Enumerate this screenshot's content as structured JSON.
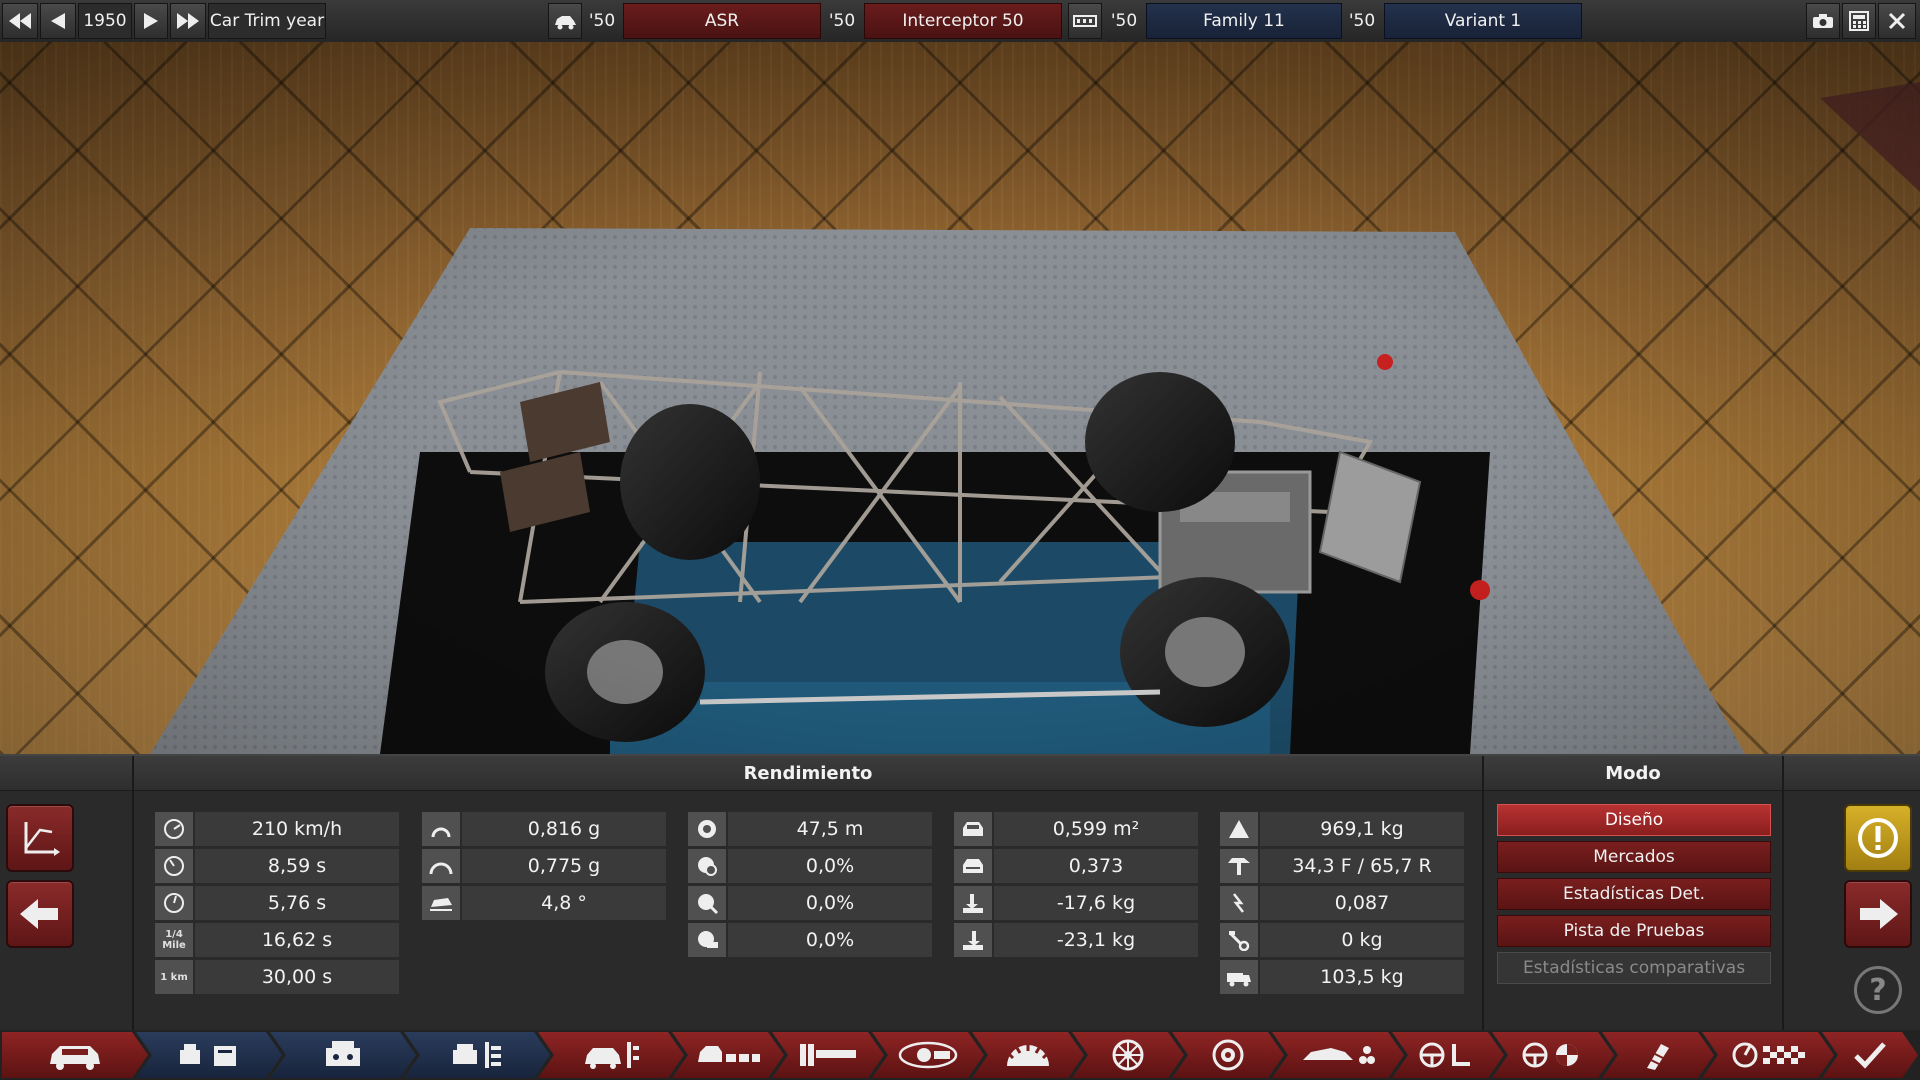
{
  "topbar": {
    "year": "1950",
    "year_label": "Car Trim year",
    "model_year": "'50",
    "model_name": "ASR",
    "trim_year": "'50",
    "trim_name": "Interceptor 50",
    "family_year": "'50",
    "family_name": "Family 11",
    "variant_year": "'50",
    "variant_name": "Variant 1",
    "icons": [
      "rewind-icon",
      "step-back-icon",
      "step-forward-icon",
      "fast-forward-icon",
      "car-model-icon",
      "engine-family-icon",
      "camera-icon",
      "calculator-icon",
      "close-icon"
    ]
  },
  "panel": {
    "performance_title": "Rendimiento",
    "mode_title": "Modo",
    "stats": {
      "col1": [
        {
          "icon": "top-speed-icon",
          "value": "210 km/h"
        },
        {
          "icon": "acceleration-0-100-icon",
          "value": "8,59 s"
        },
        {
          "icon": "acceleration-0-60-icon",
          "value": "5,76 s"
        },
        {
          "icon": "quarter-mile-icon",
          "value": "16,62 s",
          "icon_text": "1/4 Mile"
        },
        {
          "icon": "one-km-icon",
          "value": "30,00 s",
          "icon_text": "1 km"
        }
      ],
      "col2": [
        {
          "icon": "cornering-grip-icon",
          "value": "0,816 g"
        },
        {
          "icon": "cornering-grip-2-icon",
          "value": "0,775 g"
        },
        {
          "icon": "body-roll-icon",
          "value": "4,8 °"
        }
      ],
      "col3": [
        {
          "icon": "braking-distance-icon",
          "value": "47,5 m"
        },
        {
          "icon": "brake-fade-icon",
          "value": "0,0%"
        },
        {
          "icon": "brake-fade-2-icon",
          "value": "0,0%"
        },
        {
          "icon": "brake-fade-3-icon",
          "value": "0,0%"
        }
      ],
      "col4": [
        {
          "icon": "frontal-area-icon",
          "value": "0,599 m²"
        },
        {
          "icon": "drag-coefficient-icon",
          "value": "0,373"
        },
        {
          "icon": "front-downforce-icon",
          "value": "-17,6 kg"
        },
        {
          "icon": "rear-downforce-icon",
          "value": "-23,1 kg"
        }
      ],
      "col5": [
        {
          "icon": "weight-icon",
          "value": "969,1 kg"
        },
        {
          "icon": "weight-distribution-icon",
          "value": "34,3 F / 65,7 R"
        },
        {
          "icon": "weight-ratio-icon",
          "value": "0,087"
        },
        {
          "icon": "towing-icon",
          "value": "0 kg"
        },
        {
          "icon": "cargo-icon",
          "value": "103,5 kg"
        }
      ]
    },
    "modes": [
      {
        "label": "Diseño",
        "state": "active"
      },
      {
        "label": "Mercados",
        "state": "normal"
      },
      {
        "label": "Estadísticas Det.",
        "state": "normal"
      },
      {
        "label": "Pista de Pruebas",
        "state": "normal"
      },
      {
        "label": "Estadísticas comparativas",
        "state": "disabled"
      }
    ],
    "help_glyph": "?",
    "warning_glyph": "!"
  },
  "nav": {
    "items": [
      {
        "name": "car-model",
        "color": "red"
      },
      {
        "name": "chassis-family",
        "color": "blue"
      },
      {
        "name": "engine-family",
        "color": "blue"
      },
      {
        "name": "engine-variant",
        "color": "blue"
      },
      {
        "name": "car-trim",
        "color": "red"
      },
      {
        "name": "body",
        "color": "red"
      },
      {
        "name": "drivetrain",
        "color": "red"
      },
      {
        "name": "engine-placement",
        "color": "red"
      },
      {
        "name": "suspension",
        "color": "red"
      },
      {
        "name": "wheels",
        "color": "red"
      },
      {
        "name": "brakes",
        "color": "red"
      },
      {
        "name": "aero",
        "color": "red"
      },
      {
        "name": "interior",
        "color": "red"
      },
      {
        "name": "safety",
        "color": "red"
      },
      {
        "name": "fuel-system",
        "color": "red"
      },
      {
        "name": "testing",
        "color": "red"
      },
      {
        "name": "finish",
        "color": "red"
      }
    ]
  }
}
